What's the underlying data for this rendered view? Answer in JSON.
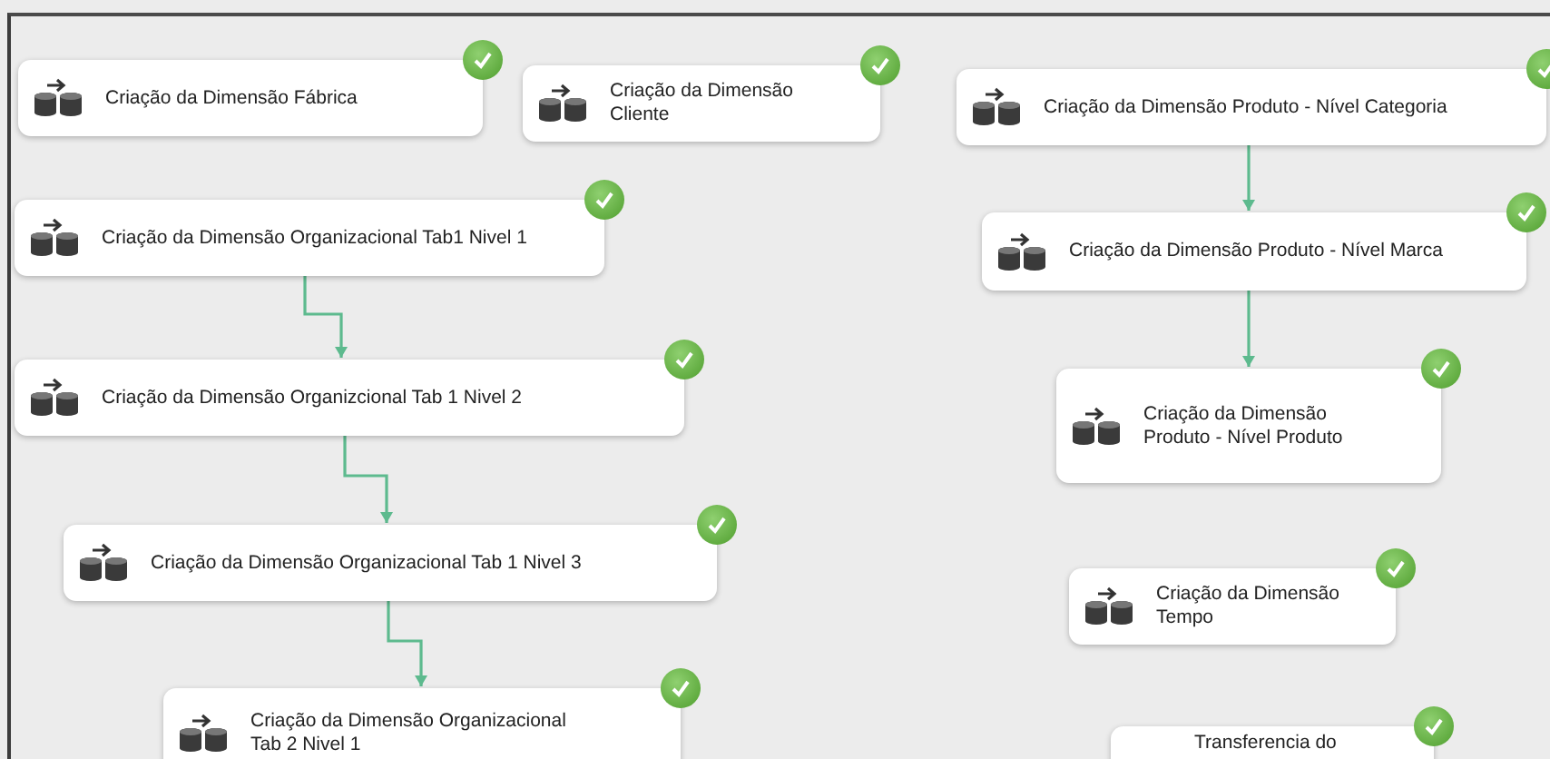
{
  "control_flow": {
    "tasks": [
      {
        "label": "Criação da Dimensão Fábrica",
        "succeeded": true
      },
      {
        "label": "Criação da Dimensão Cliente",
        "succeeded": true
      },
      {
        "label": "Criação da Dimensão Produto - Nível Categoria",
        "succeeded": true,
        "then": {
          "label": "Criação da Dimensão Produto - Nível Marca",
          "succeeded": true,
          "then": {
            "label": "Criação da Dimensão Produto - Nível Produto",
            "succeeded": true
          }
        }
      },
      {
        "label": "Criação da Dimensão Organizacional Tab1 Nivel 1",
        "succeeded": true,
        "then": {
          "label": "Criação da Dimensão Organizcional Tab 1 Nivel 2",
          "succeeded": true,
          "then": {
            "label": "Criação da Dimensão Organizacional Tab 1 Nivel 3",
            "succeeded": true,
            "then": {
              "label": "Criação da Dimensão Organizacional Tab 2 Nivel 1",
              "succeeded": true
            }
          }
        }
      },
      {
        "label": "Criação da Dimensão Tempo",
        "succeeded": true
      },
      {
        "label": "Transferencia do",
        "succeeded": true
      }
    ]
  }
}
